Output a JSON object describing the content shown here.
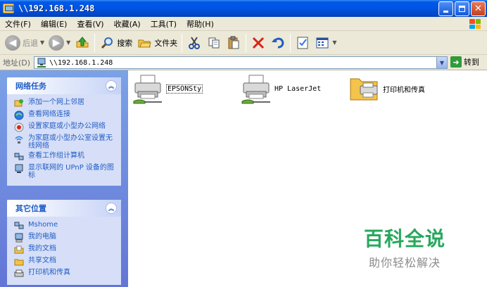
{
  "window": {
    "title": "\\\\192.168.1.248",
    "minimize_icon": "minimize-icon",
    "maximize_icon": "maximize-icon",
    "close_label": "✕"
  },
  "menu": {
    "items": [
      "文件(F)",
      "编辑(E)",
      "查看(V)",
      "收藏(A)",
      "工具(T)",
      "帮助(H)"
    ]
  },
  "toolbar": {
    "back_label": "后退",
    "search_label": "搜索",
    "folders_label": "文件夹"
  },
  "address": {
    "label": "地址(D)",
    "value": "\\\\192.168.1.248",
    "go_label": "转到"
  },
  "tasks_panel": {
    "title": "网络任务",
    "items": [
      {
        "icon": "add-network-place-icon",
        "label": "添加一个网上邻居"
      },
      {
        "icon": "network-connections-icon",
        "label": "查看网络连接"
      },
      {
        "icon": "home-network-setup-icon",
        "label": "设置家庭或小型办公网络"
      },
      {
        "icon": "wireless-setup-icon",
        "label": "为家庭或小型办公室设置无线网络"
      },
      {
        "icon": "workgroup-computers-icon",
        "label": "查看工作组计算机"
      },
      {
        "icon": "upnp-devices-icon",
        "label": "显示联网的 UPnP 设备的图标"
      }
    ]
  },
  "places_panel": {
    "title": "其它位置",
    "items": [
      {
        "icon": "network-computer-icon",
        "label": "Mshome"
      },
      {
        "icon": "my-computer-icon",
        "label": "我的电脑"
      },
      {
        "icon": "my-documents-icon",
        "label": "我的文档"
      },
      {
        "icon": "shared-documents-icon",
        "label": "共享文档"
      },
      {
        "icon": "printers-faxes-icon",
        "label": "打印机和传真"
      }
    ]
  },
  "content": {
    "items": [
      {
        "icon": "printer-share-icon",
        "label": "EPSONSty",
        "selected": true
      },
      {
        "icon": "printer-share-icon",
        "label": "HP LaserJet",
        "selected": false
      },
      {
        "icon": "printers-folder-icon",
        "label": "打印机和传真",
        "selected": false
      }
    ]
  },
  "watermark": {
    "main": "百科全说",
    "sub": "助你轻松解决"
  },
  "colors": {
    "titlebar": "#0054e3",
    "task_link": "#215dc6",
    "watermark_green": "#27a85c",
    "pane_bg": "#7ba2e7"
  }
}
